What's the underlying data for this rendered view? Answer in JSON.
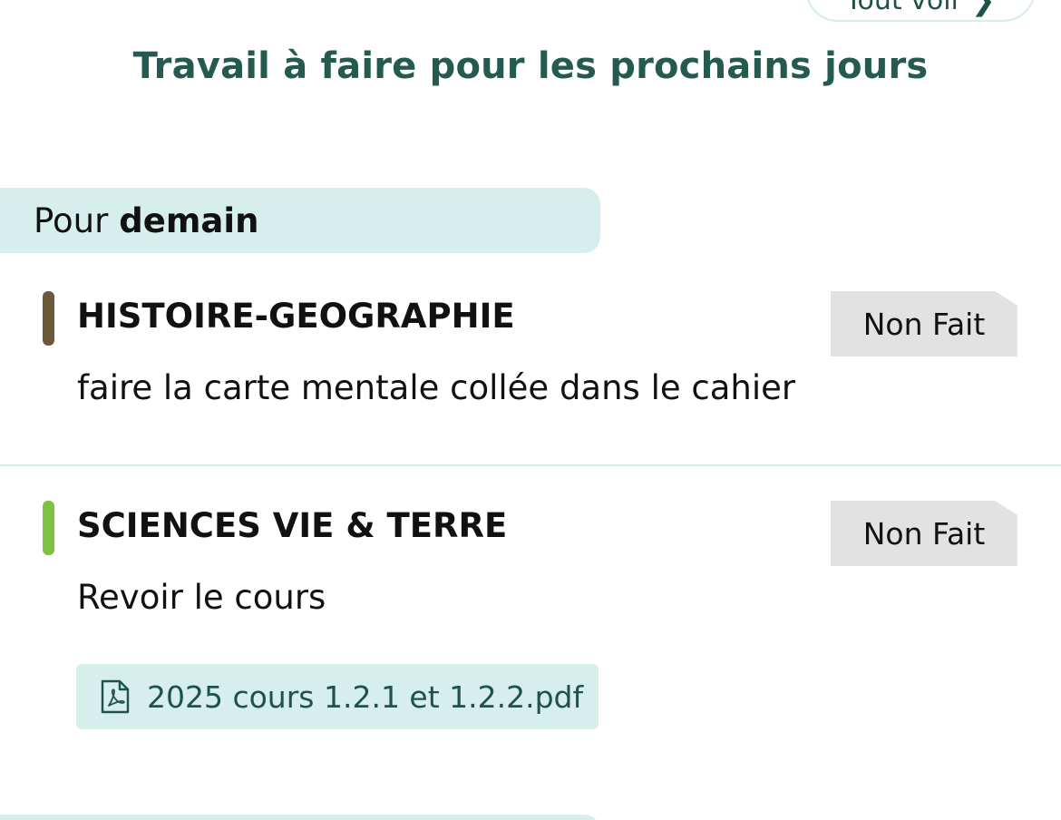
{
  "header": {
    "see_all_label": "Tout voir",
    "see_all_icon": "chevron-right-icon",
    "section_title": "Travail à faire pour les prochains jours"
  },
  "day_group": {
    "prefix": "Pour",
    "day": "demain"
  },
  "homework": [
    {
      "subject": "HISTOIRE-GEOGRAPHIE",
      "color": "#6b5a3a",
      "task": "faire la carte mentale collée dans le cahier",
      "status": "Non Fait"
    },
    {
      "subject": "SCIENCES VIE & TERRE",
      "color": "#7fc241",
      "task": "Revoir le cours",
      "status": "Non Fait",
      "attachment": {
        "icon": "pdf-file-icon",
        "filename": "2025 cours 1.2.1 et 1.2.2.pdf"
      }
    }
  ],
  "colors": {
    "accent": "#245a4f",
    "banner_bg": "#d6efec",
    "badge_bg": "#e2e2e2"
  }
}
